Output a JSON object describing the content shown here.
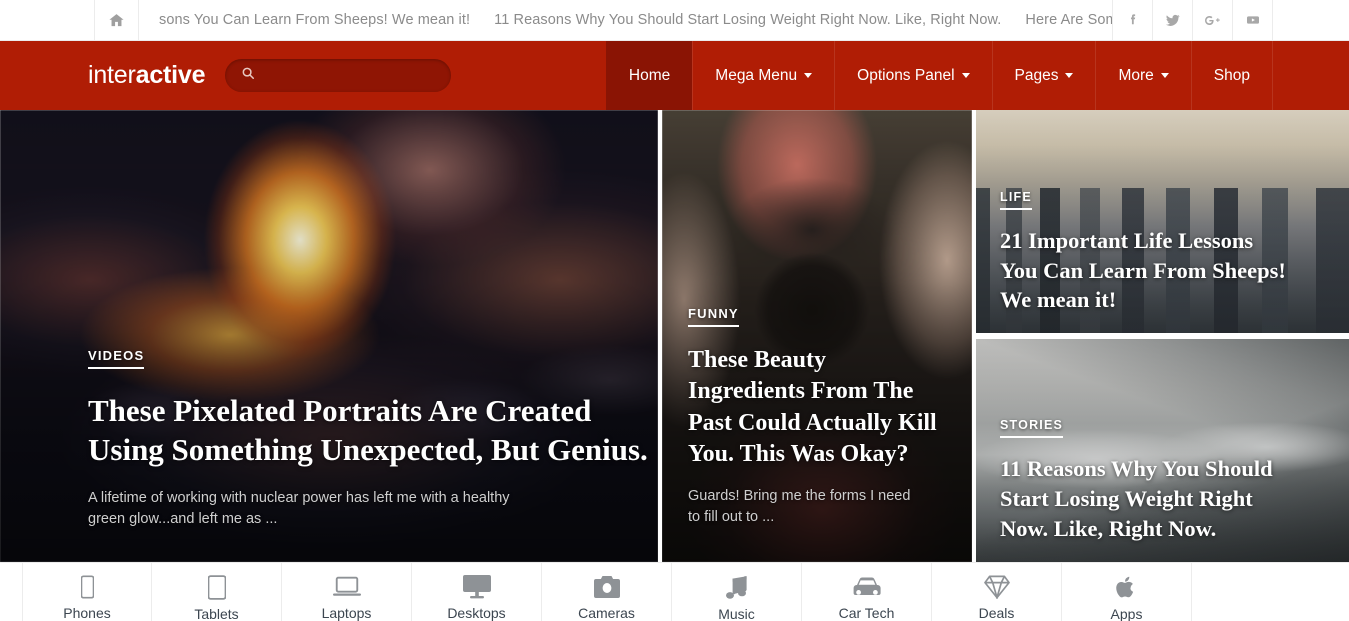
{
  "topbar": {
    "home_icon": "home-icon",
    "ticker": [
      "sons You Can Learn From Sheeps! We mean it!",
      "11 Reasons Why You Should Start Losing Weight Right Now. Like, Right Now.",
      "Here Are Some Cats Who"
    ],
    "social": [
      {
        "name": "facebook-icon",
        "label": "f"
      },
      {
        "name": "twitter-icon",
        "label": "t"
      },
      {
        "name": "googleplus-icon",
        "label": "G+"
      },
      {
        "name": "youtube-icon",
        "label": "yt"
      }
    ]
  },
  "navbar": {
    "brand_thin": "inter",
    "brand_bold": "active",
    "background": "#b01d05",
    "active_background": "#8a1404",
    "search": {
      "value": "",
      "placeholder": "",
      "icon": "search-icon"
    },
    "items": [
      {
        "label": "Home",
        "caret": false,
        "active": true
      },
      {
        "label": "Mega Menu",
        "caret": true,
        "active": false
      },
      {
        "label": "Options Panel",
        "caret": true,
        "active": false
      },
      {
        "label": "Pages",
        "caret": true,
        "active": false
      },
      {
        "label": "More",
        "caret": true,
        "active": false
      },
      {
        "label": "Shop",
        "caret": false,
        "active": false
      }
    ]
  },
  "hero": {
    "main": {
      "category": "VIDEOS",
      "title": "These Pixelated Portraits Are Created Using Something Unexpected, But Genius.",
      "excerpt": "A lifetime of working with nuclear power has left me with a healthy green glow...and left me as ...",
      "image": "bonfire-embers-photo"
    },
    "mid": {
      "category": "FUNNY",
      "title": "These Beauty Ingredients From The Past Could Actually Kill You. This Was Okay?",
      "excerpt": "Guards! Bring me the forms I need to fill out to ...",
      "image": "hands-holding-canon-camera-photo"
    },
    "right": [
      {
        "category": "LIFE",
        "title": "21 Important Life Lessons You Can Learn From Sheeps! We mean it!",
        "image": "city-skyline-photo"
      },
      {
        "category": "STORIES",
        "title": "11 Reasons Why You Should Start Losing Weight Right Now. Like, Right Now.",
        "image": "snowy-mountains-photo"
      }
    ]
  },
  "categories": [
    {
      "label": "Phones",
      "icon": "phone-icon"
    },
    {
      "label": "Tablets",
      "icon": "tablet-icon"
    },
    {
      "label": "Laptops",
      "icon": "laptop-icon"
    },
    {
      "label": "Desktops",
      "icon": "desktop-icon"
    },
    {
      "label": "Cameras",
      "icon": "camera-icon"
    },
    {
      "label": "Music",
      "icon": "music-note-icon"
    },
    {
      "label": "Car Tech",
      "icon": "car-icon"
    },
    {
      "label": "Deals",
      "icon": "diamond-icon"
    },
    {
      "label": "Apps",
      "icon": "apple-icon"
    }
  ]
}
